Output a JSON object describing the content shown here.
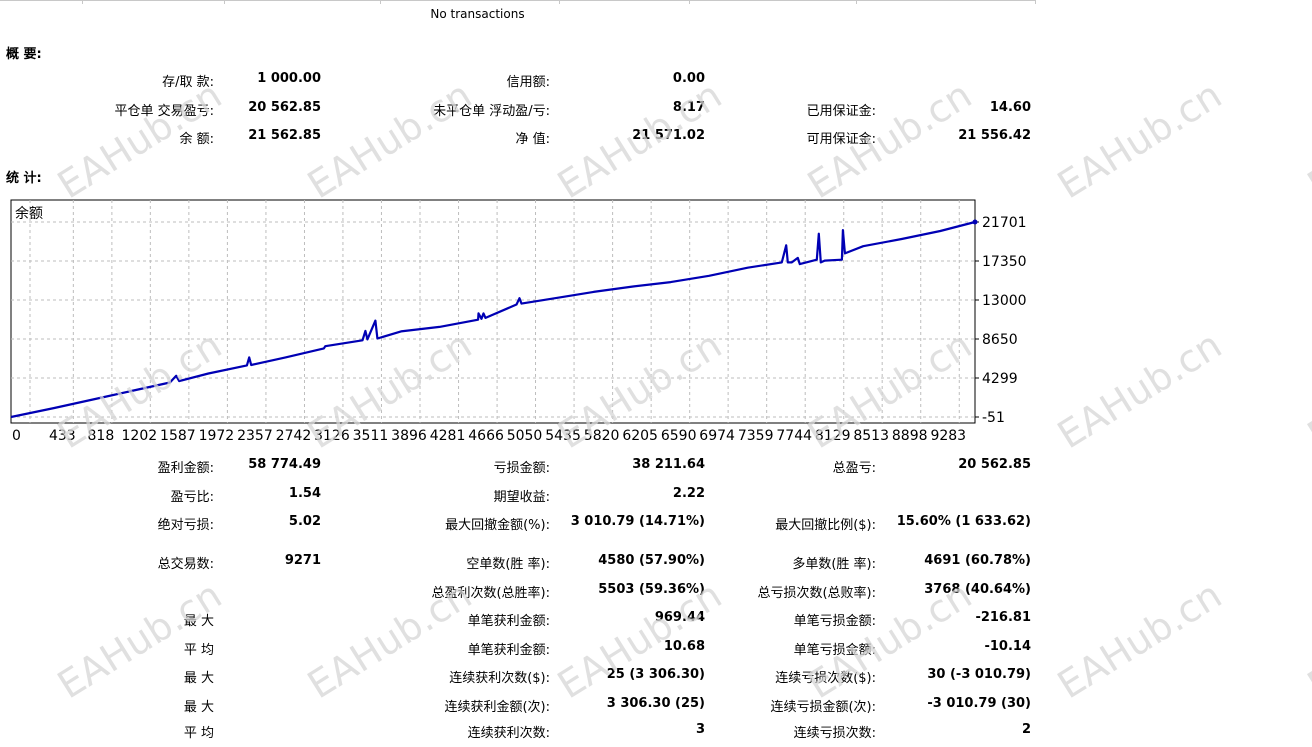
{
  "top": {
    "no_transactions": "No transactions"
  },
  "summary": {
    "title": "概 要:",
    "rows": [
      [
        {
          "label": "存/取 款:",
          "value": "1 000.00"
        },
        {
          "label": "信用额:",
          "value": "0.00"
        },
        {
          "label": "",
          "value": ""
        }
      ],
      [
        {
          "label": "平仓单 交易盈亏:",
          "value": "20 562.85"
        },
        {
          "label": "未平仓单 浮动盈/亏:",
          "value": "8.17"
        },
        {
          "label": "已用保证金:",
          "value": "14.60"
        }
      ],
      [
        {
          "label": "余 额:",
          "value": "21 562.85"
        },
        {
          "label": "净 值:",
          "value": "21 571.02"
        },
        {
          "label": "可用保证金:",
          "value": "21 556.42"
        }
      ]
    ]
  },
  "stats": {
    "title": "统 计:",
    "rows": [
      [
        {
          "label": "盈利金额:",
          "value": "58 774.49"
        },
        {
          "label": "亏损金额:",
          "value": "38 211.64"
        },
        {
          "label": "总盈亏:",
          "value": "20 562.85"
        }
      ],
      [
        {
          "label": "盈亏比:",
          "value": "1.54"
        },
        {
          "label": "期望收益:",
          "value": "2.22"
        },
        {
          "label": "",
          "value": ""
        }
      ],
      [
        {
          "label": "绝对亏损:",
          "value": "5.02"
        },
        {
          "label": "最大回撤金额(%):",
          "value": "3 010.79 (14.71%)"
        },
        {
          "label": "最大回撤比例($):",
          "value": "15.60% (1 633.62)"
        }
      ],
      [
        {
          "label": "总交易数:",
          "value": "9271"
        },
        {
          "label": "空单数(胜 率):",
          "value": "4580 (57.90%)"
        },
        {
          "label": "多单数(胜 率):",
          "value": "4691 (60.78%)"
        }
      ],
      [
        {
          "label": "",
          "value": ""
        },
        {
          "label": "总盈利次数(总胜率):",
          "value": "5503 (59.36%)"
        },
        {
          "label": "总亏损次数(总败率):",
          "value": "3768 (40.64%)"
        }
      ],
      [
        {
          "label": "最 大",
          "value": ""
        },
        {
          "label": "单笔获利金额:",
          "value": "969.44"
        },
        {
          "label": "单笔亏损金额:",
          "value": "-216.81"
        }
      ],
      [
        {
          "label": "平 均",
          "value": ""
        },
        {
          "label": "单笔获利金额:",
          "value": "10.68"
        },
        {
          "label": "单笔亏损金额:",
          "value": "-10.14"
        }
      ],
      [
        {
          "label": "最 大",
          "value": ""
        },
        {
          "label": "连续获利次数($):",
          "value": "25 (3 306.30)"
        },
        {
          "label": "连续亏损次数($):",
          "value": "30 (-3 010.79)"
        }
      ],
      [
        {
          "label": "最 大",
          "value": ""
        },
        {
          "label": "连续获利金额(次):",
          "value": "3 306.30 (25)"
        },
        {
          "label": "连续亏损金额(次):",
          "value": "-3 010.79 (30)"
        }
      ],
      [
        {
          "label": "平 均",
          "value": ""
        },
        {
          "label": "连续获利次数:",
          "value": "3"
        },
        {
          "label": "连续亏损次数:",
          "value": "2"
        }
      ]
    ]
  },
  "watermark": {
    "text": "EAHub.cn",
    "color": "#d6d6d6"
  },
  "chart_data": {
    "type": "line",
    "title": "余额",
    "series": [
      {
        "name": "余额",
        "color": "#0000b4",
        "points": [
          [
            0,
            -51
          ],
          [
            433,
            950
          ],
          [
            818,
            1900
          ],
          [
            1202,
            2850
          ],
          [
            1587,
            3800
          ],
          [
            1650,
            4550
          ],
          [
            1680,
            3950
          ],
          [
            1972,
            4800
          ],
          [
            2357,
            5700
          ],
          [
            2380,
            6600
          ],
          [
            2400,
            5750
          ],
          [
            2742,
            6600
          ],
          [
            3126,
            7600
          ],
          [
            3140,
            7850
          ],
          [
            3511,
            8500
          ],
          [
            3540,
            9550
          ],
          [
            3560,
            8600
          ],
          [
            3640,
            10700
          ],
          [
            3660,
            8700
          ],
          [
            3896,
            9500
          ],
          [
            4281,
            10000
          ],
          [
            4666,
            10800
          ],
          [
            4670,
            11500
          ],
          [
            4700,
            10900
          ],
          [
            4720,
            11500
          ],
          [
            4740,
            11000
          ],
          [
            5050,
            12500
          ],
          [
            5080,
            13200
          ],
          [
            5100,
            12600
          ],
          [
            5435,
            13200
          ],
          [
            5820,
            13900
          ],
          [
            6205,
            14500
          ],
          [
            6590,
            15000
          ],
          [
            6974,
            15700
          ],
          [
            7359,
            16600
          ],
          [
            7700,
            17200
          ],
          [
            7744,
            19100
          ],
          [
            7760,
            17200
          ],
          [
            7800,
            17200
          ],
          [
            7860,
            17700
          ],
          [
            7880,
            17000
          ],
          [
            8050,
            17500
          ],
          [
            8070,
            20400
          ],
          [
            8090,
            17200
          ],
          [
            8129,
            17400
          ],
          [
            8300,
            17500
          ],
          [
            8310,
            20800
          ],
          [
            8330,
            18200
          ],
          [
            8513,
            19000
          ],
          [
            8898,
            19800
          ],
          [
            9283,
            20700
          ],
          [
            9630,
            21701
          ]
        ]
      }
    ],
    "x_ticks": [
      0,
      433,
      818,
      1202,
      1587,
      1972,
      2357,
      2742,
      3126,
      3511,
      3896,
      4281,
      4666,
      5050,
      5435,
      5820,
      6205,
      6590,
      6974,
      7359,
      7744,
      8129,
      8513,
      8898,
      9283
    ],
    "x_tick_labels": [
      "0",
      "433",
      "818",
      "1202",
      "1587",
      "1972",
      "2357",
      "2742",
      "3126",
      "3511",
      "3896",
      "4281",
      "4666",
      "5050",
      "5435",
      "5820",
      "6205",
      "6590",
      "6974",
      "7359",
      "7744",
      "8129",
      "8513",
      "8898",
      "9283"
    ],
    "y_ticks": [
      21701,
      17350,
      13000,
      8650,
      4299,
      -51
    ],
    "y_tick_labels": [
      "21701",
      "17350",
      "13000",
      "8650",
      "4299",
      "-51"
    ],
    "xlim": [
      0,
      9630
    ],
    "ylim": [
      -51,
      21701
    ],
    "grid": true
  }
}
